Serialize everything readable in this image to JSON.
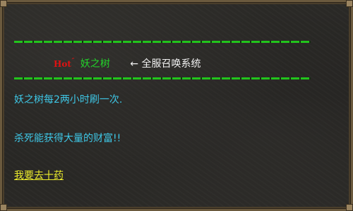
{
  "header": {
    "hot_badge": "Hot",
    "hot_mark": "˝",
    "tree_name": "妖之树",
    "arrow_icon": "←",
    "system_label": "全服召唤系统"
  },
  "body": {
    "line1": "妖之树每2两小时刷一次.",
    "line2": "杀死能获得大量的财富!!",
    "link": "我要去十药"
  },
  "colors": {
    "divider": "#22c41c",
    "hot": "#e01212",
    "tree_name": "#23d32a",
    "info_text": "#3ec7e6",
    "link": "#ecec2c",
    "label": "#f2f2f2"
  }
}
